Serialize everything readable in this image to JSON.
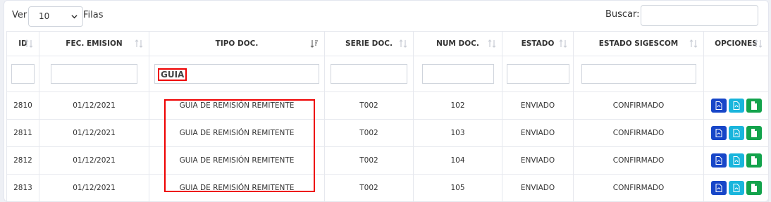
{
  "toolbar": {
    "ver_label": "Ver",
    "length_value": "10",
    "filas_label": "Filas",
    "buscar_label": "Buscar:",
    "search_value": ""
  },
  "columns": [
    "ID",
    "FEC. EMISION",
    "TIPO DOC.",
    "SERIE DOC.",
    "NUM DOC.",
    "ESTADO",
    "ESTADO SIGESCOM",
    "OPCIONES"
  ],
  "filters": {
    "id": "",
    "fec_emision": "",
    "tipo_doc": "GUIA",
    "serie_doc": "",
    "num_doc": "",
    "estado": "",
    "estado_sigescom": ""
  },
  "rows": [
    {
      "id": "2810",
      "fec": "01/12/2021",
      "tipo": "GUIA DE REMISIÓN REMITENTE",
      "serie": "T002",
      "num": "102",
      "estado": "ENVIADO",
      "sigescom": "CONFIRMADO"
    },
    {
      "id": "2811",
      "fec": "01/12/2021",
      "tipo": "GUIA DE REMISIÓN REMITENTE",
      "serie": "T002",
      "num": "103",
      "estado": "ENVIADO",
      "sigescom": "CONFIRMADO"
    },
    {
      "id": "2812",
      "fec": "01/12/2021",
      "tipo": "GUIA DE REMISIÓN REMITENTE",
      "serie": "T002",
      "num": "104",
      "estado": "ENVIADO",
      "sigescom": "CONFIRMADO"
    },
    {
      "id": "2813",
      "fec": "01/12/2021",
      "tipo": "GUIA DE REMISIÓN REMITENTE",
      "serie": "T002",
      "num": "105",
      "estado": "ENVIADO",
      "sigescom": "CONFIRMADO"
    }
  ],
  "colors": {
    "pdf": "#1746c8",
    "xml": "#19b5dc",
    "doc": "#13a34c",
    "highlight": "#e00000"
  }
}
